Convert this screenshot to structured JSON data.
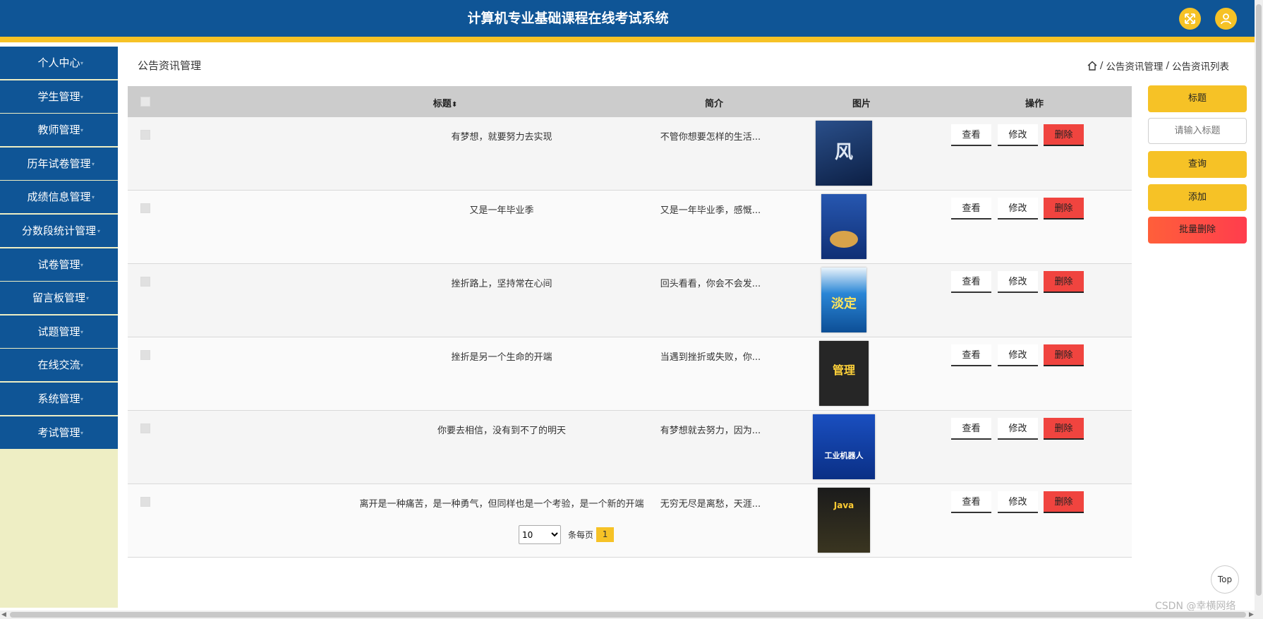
{
  "header": {
    "title": "计算机专业基础课程在线考试系统"
  },
  "sidebar": {
    "items": [
      {
        "label": "个人中心"
      },
      {
        "label": "学生管理"
      },
      {
        "label": "教师管理"
      },
      {
        "label": "历年试卷管理"
      },
      {
        "label": "成绩信息管理"
      },
      {
        "label": "分数段统计管理"
      },
      {
        "label": "试卷管理"
      },
      {
        "label": "留言板管理"
      },
      {
        "label": "试题管理"
      },
      {
        "label": "在线交流"
      },
      {
        "label": "系统管理"
      },
      {
        "label": "考试管理"
      }
    ]
  },
  "page": {
    "title": "公告资讯管理",
    "breadcrumb": [
      "公告资讯管理",
      "公告资讯列表"
    ]
  },
  "table": {
    "headers": {
      "title": "标题",
      "desc": "简介",
      "image": "图片",
      "ops": "操作"
    },
    "sort_icon": "sort-icon",
    "rows": [
      {
        "title": "有梦想，就要努力去实现",
        "desc": "不管你想要怎样的生活...",
        "cover": {
          "text": "风",
          "bg": "#1d3a6e"
        }
      },
      {
        "title": "又是一年毕业季",
        "desc": "又是一年毕业季，感慨...",
        "cover": {
          "text": "",
          "bg": "#1c4a9a"
        }
      },
      {
        "title": "挫折路上，坚持常在心间",
        "desc": "回头看看，你会不会发...",
        "cover": {
          "text": "淡定",
          "bg": "#1565b0"
        }
      },
      {
        "title": "挫折是另一个生命的开端",
        "desc": "当遇到挫折或失败，你...",
        "cover": {
          "text": "管理",
          "bg": "#2a2a2a"
        }
      },
      {
        "title": "你要去相信，没有到不了的明天",
        "desc": "有梦想就去努力，因为...",
        "cover": {
          "text": "工业机器人",
          "bg": "#1040a8"
        }
      },
      {
        "title": "离开是一种痛苦，是一种勇气，但同样也是一个考验，是一个新的开端",
        "desc": "无穷无尽是离愁，天涯...",
        "cover": {
          "text": "Java",
          "bg": "#222222"
        }
      }
    ],
    "ops": {
      "view": "查看",
      "edit": "修改",
      "delete": "删除"
    }
  },
  "pagination": {
    "page_size": "10",
    "per_page_label": "条每页",
    "current": "1"
  },
  "search_panel": {
    "title_btn": "标题",
    "placeholder": "请输入标题",
    "query_btn": "查询",
    "add_btn": "添加",
    "batch_delete_btn": "批量删除"
  },
  "misc": {
    "top": "Top",
    "watermark": "CSDN @幸横网络"
  },
  "colors": {
    "header": "#0f5596",
    "accent": "#f6c226",
    "danger": "#f0443f",
    "sidebar_bg": "#eeeec4"
  }
}
